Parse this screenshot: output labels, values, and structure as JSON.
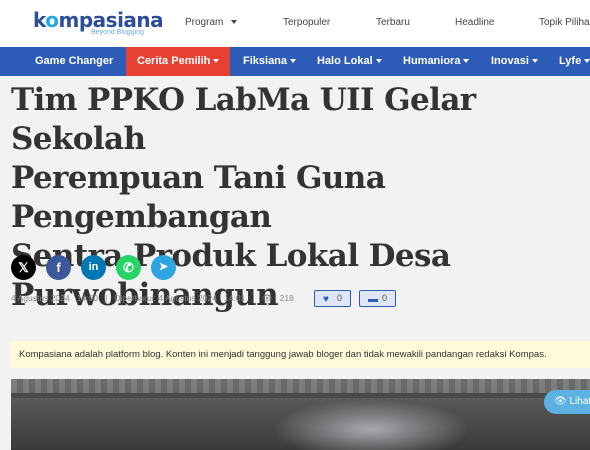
{
  "header": {
    "logo_text_pre": "k",
    "logo_text_o": "o",
    "logo_text_post": "mpasiana",
    "logo_tagline": "Beyond Blogging",
    "nav": [
      {
        "label": "Program",
        "dropdown": true
      },
      {
        "label": "Terpopuler"
      },
      {
        "label": "Terbaru"
      },
      {
        "label": "Headline"
      },
      {
        "label": "Topik Pilihan"
      }
    ]
  },
  "categories": [
    {
      "label": "Game Changer",
      "dropdown": false,
      "active": false
    },
    {
      "label": "Cerita Pemilih",
      "dropdown": true,
      "active": true
    },
    {
      "label": "Fiksiana",
      "dropdown": true,
      "active": false
    },
    {
      "label": "Halo Lokal",
      "dropdown": true,
      "active": false
    },
    {
      "label": "Humaniora",
      "dropdown": true,
      "active": false
    },
    {
      "label": "Inovasi",
      "dropdown": true,
      "active": false
    },
    {
      "label": "Lyfe",
      "dropdown": true,
      "active": false
    }
  ],
  "article": {
    "title_lines": [
      "Tim PPKO LabMa UII Gelar Sekolah",
      "Perempuan Tani Guna Pengembangan",
      "Sentra Produk Lokal Desa",
      "Purwobinangun"
    ],
    "share": [
      {
        "icon": "x-twitter-icon",
        "glyph": "𝕏",
        "color": "#000000"
      },
      {
        "icon": "facebook-icon",
        "glyph": "f",
        "color": "#3b5998"
      },
      {
        "icon": "linkedin-icon",
        "glyph": "in",
        "color": "#0077b5"
      },
      {
        "icon": "whatsapp-icon",
        "glyph": "✆",
        "color": "#25d366"
      },
      {
        "icon": "telegram-icon",
        "glyph": "➤",
        "color": "#2ca5e0"
      }
    ],
    "published": "4 Agustus 2024",
    "published_time": "14:00",
    "updated_label": "Diperbarui: 4 Agustus 2024",
    "updated_time": "14:01",
    "separator": "|",
    "views": "218",
    "likes": "0",
    "comments": "0",
    "disclaimer": "Kompasiana adalah platform blog. Konten ini menjadi tanggung jawab bloger dan tidak mewakili pandangan redaksi Kompas.",
    "view_image_label": "Lihat foto"
  },
  "colors": {
    "brand": "#2d4d9b",
    "category_bar": "#2d5cb8",
    "active_category": "#e64133",
    "disclaimer_bg": "#fffbd9"
  }
}
